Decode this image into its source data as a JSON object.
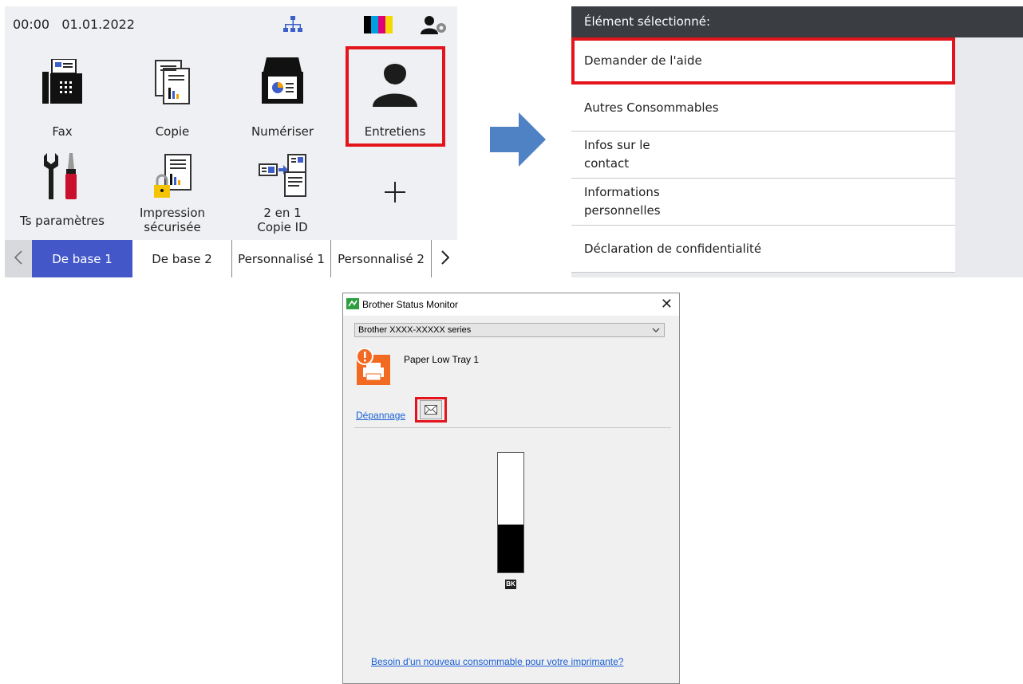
{
  "panel": {
    "status": {
      "time": "00:00",
      "date": "01.01.2022"
    },
    "tiles": [
      {
        "label": "Fax"
      },
      {
        "label": "Copie"
      },
      {
        "label": "Numériser"
      },
      {
        "label": "Entretiens"
      },
      {
        "label": "Ts paramètres"
      },
      {
        "label": "Impression\nsécurisée"
      },
      {
        "label": "2 en 1\nCopie ID"
      }
    ],
    "tabs": [
      "De base 1",
      "De base 2",
      "Personnalisé 1",
      "Personnalisé 2"
    ],
    "active_tab": "De base 1",
    "ink_colors": [
      "#000000",
      "#00a0e0",
      "#e0007a",
      "#f5d800"
    ],
    "accent": "#4357c9",
    "highlight": "#e3141c"
  },
  "menu": {
    "header": "Élément sélectionné:",
    "items": [
      "Demander de l'aide",
      "Autres Consommables",
      "Infos sur le\ncontact",
      "Informations\npersonnelles",
      "Déclaration de confidentialité"
    ],
    "highlighted": "Demander de l'aide"
  },
  "window": {
    "title": "Brother Status Monitor",
    "device": "Brother XXXX-XXXXX series",
    "status_message": "Paper Low Tray 1",
    "troubleshoot_link": "Dépannage",
    "toner_label": "BK",
    "toner_level_percent": 40,
    "supplies_link": "Besoin d'un nouveau consommable pour votre imprimante?",
    "status_icon_color": "#f26a21"
  }
}
